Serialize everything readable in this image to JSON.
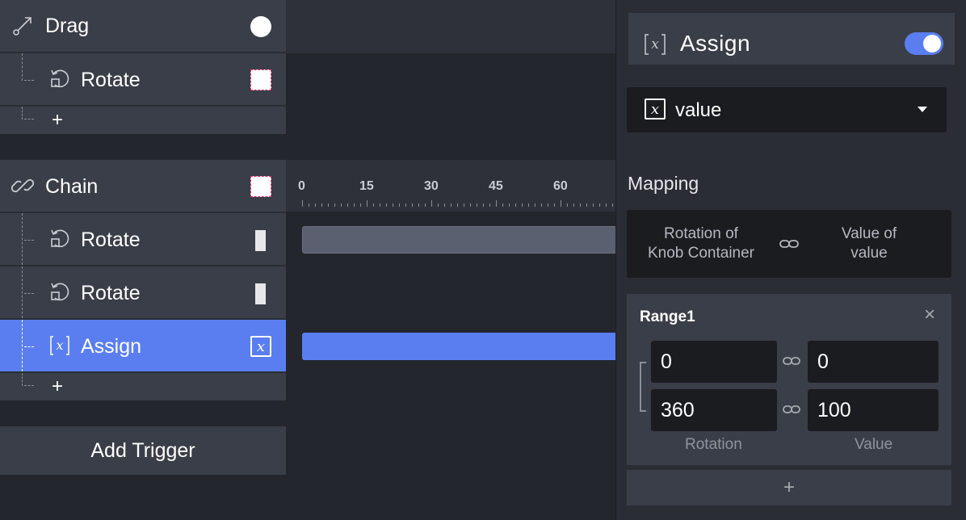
{
  "triggers": {
    "drag": {
      "label": "Drag",
      "icon": "drag-icon"
    },
    "drag_rotate": {
      "label": "Rotate",
      "icon": "rotate-icon"
    },
    "chain": {
      "label": "Chain",
      "icon": "chain-link-icon"
    },
    "chain_rotate_1": {
      "label": "Rotate",
      "icon": "rotate-icon"
    },
    "chain_rotate_2": {
      "label": "Rotate",
      "icon": "rotate-icon"
    },
    "chain_assign": {
      "label": "Assign",
      "icon": "variable-x-icon"
    },
    "plus_symbol": "+",
    "add_trigger_label": "Add Trigger"
  },
  "timeline": {
    "ticks": [
      "0",
      "15",
      "30",
      "45",
      "60"
    ]
  },
  "panel": {
    "title": "Assign",
    "title_icon": "variable-x-icon",
    "toggle_on": true,
    "select_value": "value",
    "mapping_title": "Mapping",
    "mapping_from": [
      "Rotation of",
      "Knob Container"
    ],
    "mapping_to": [
      "Value of",
      "value"
    ],
    "range": {
      "title": "Range1",
      "close_symbol": "×",
      "rotation_min": "0",
      "rotation_max": "360",
      "value_min": "0",
      "value_max": "100",
      "rotation_label": "Rotation",
      "value_label": "Value"
    },
    "add_range_symbol": "+"
  },
  "colors": {
    "accent": "#5a7ef0",
    "row_bg": "#3a3e48",
    "dark_field": "#1b1c20",
    "timeline_bar": "#5b6070"
  }
}
